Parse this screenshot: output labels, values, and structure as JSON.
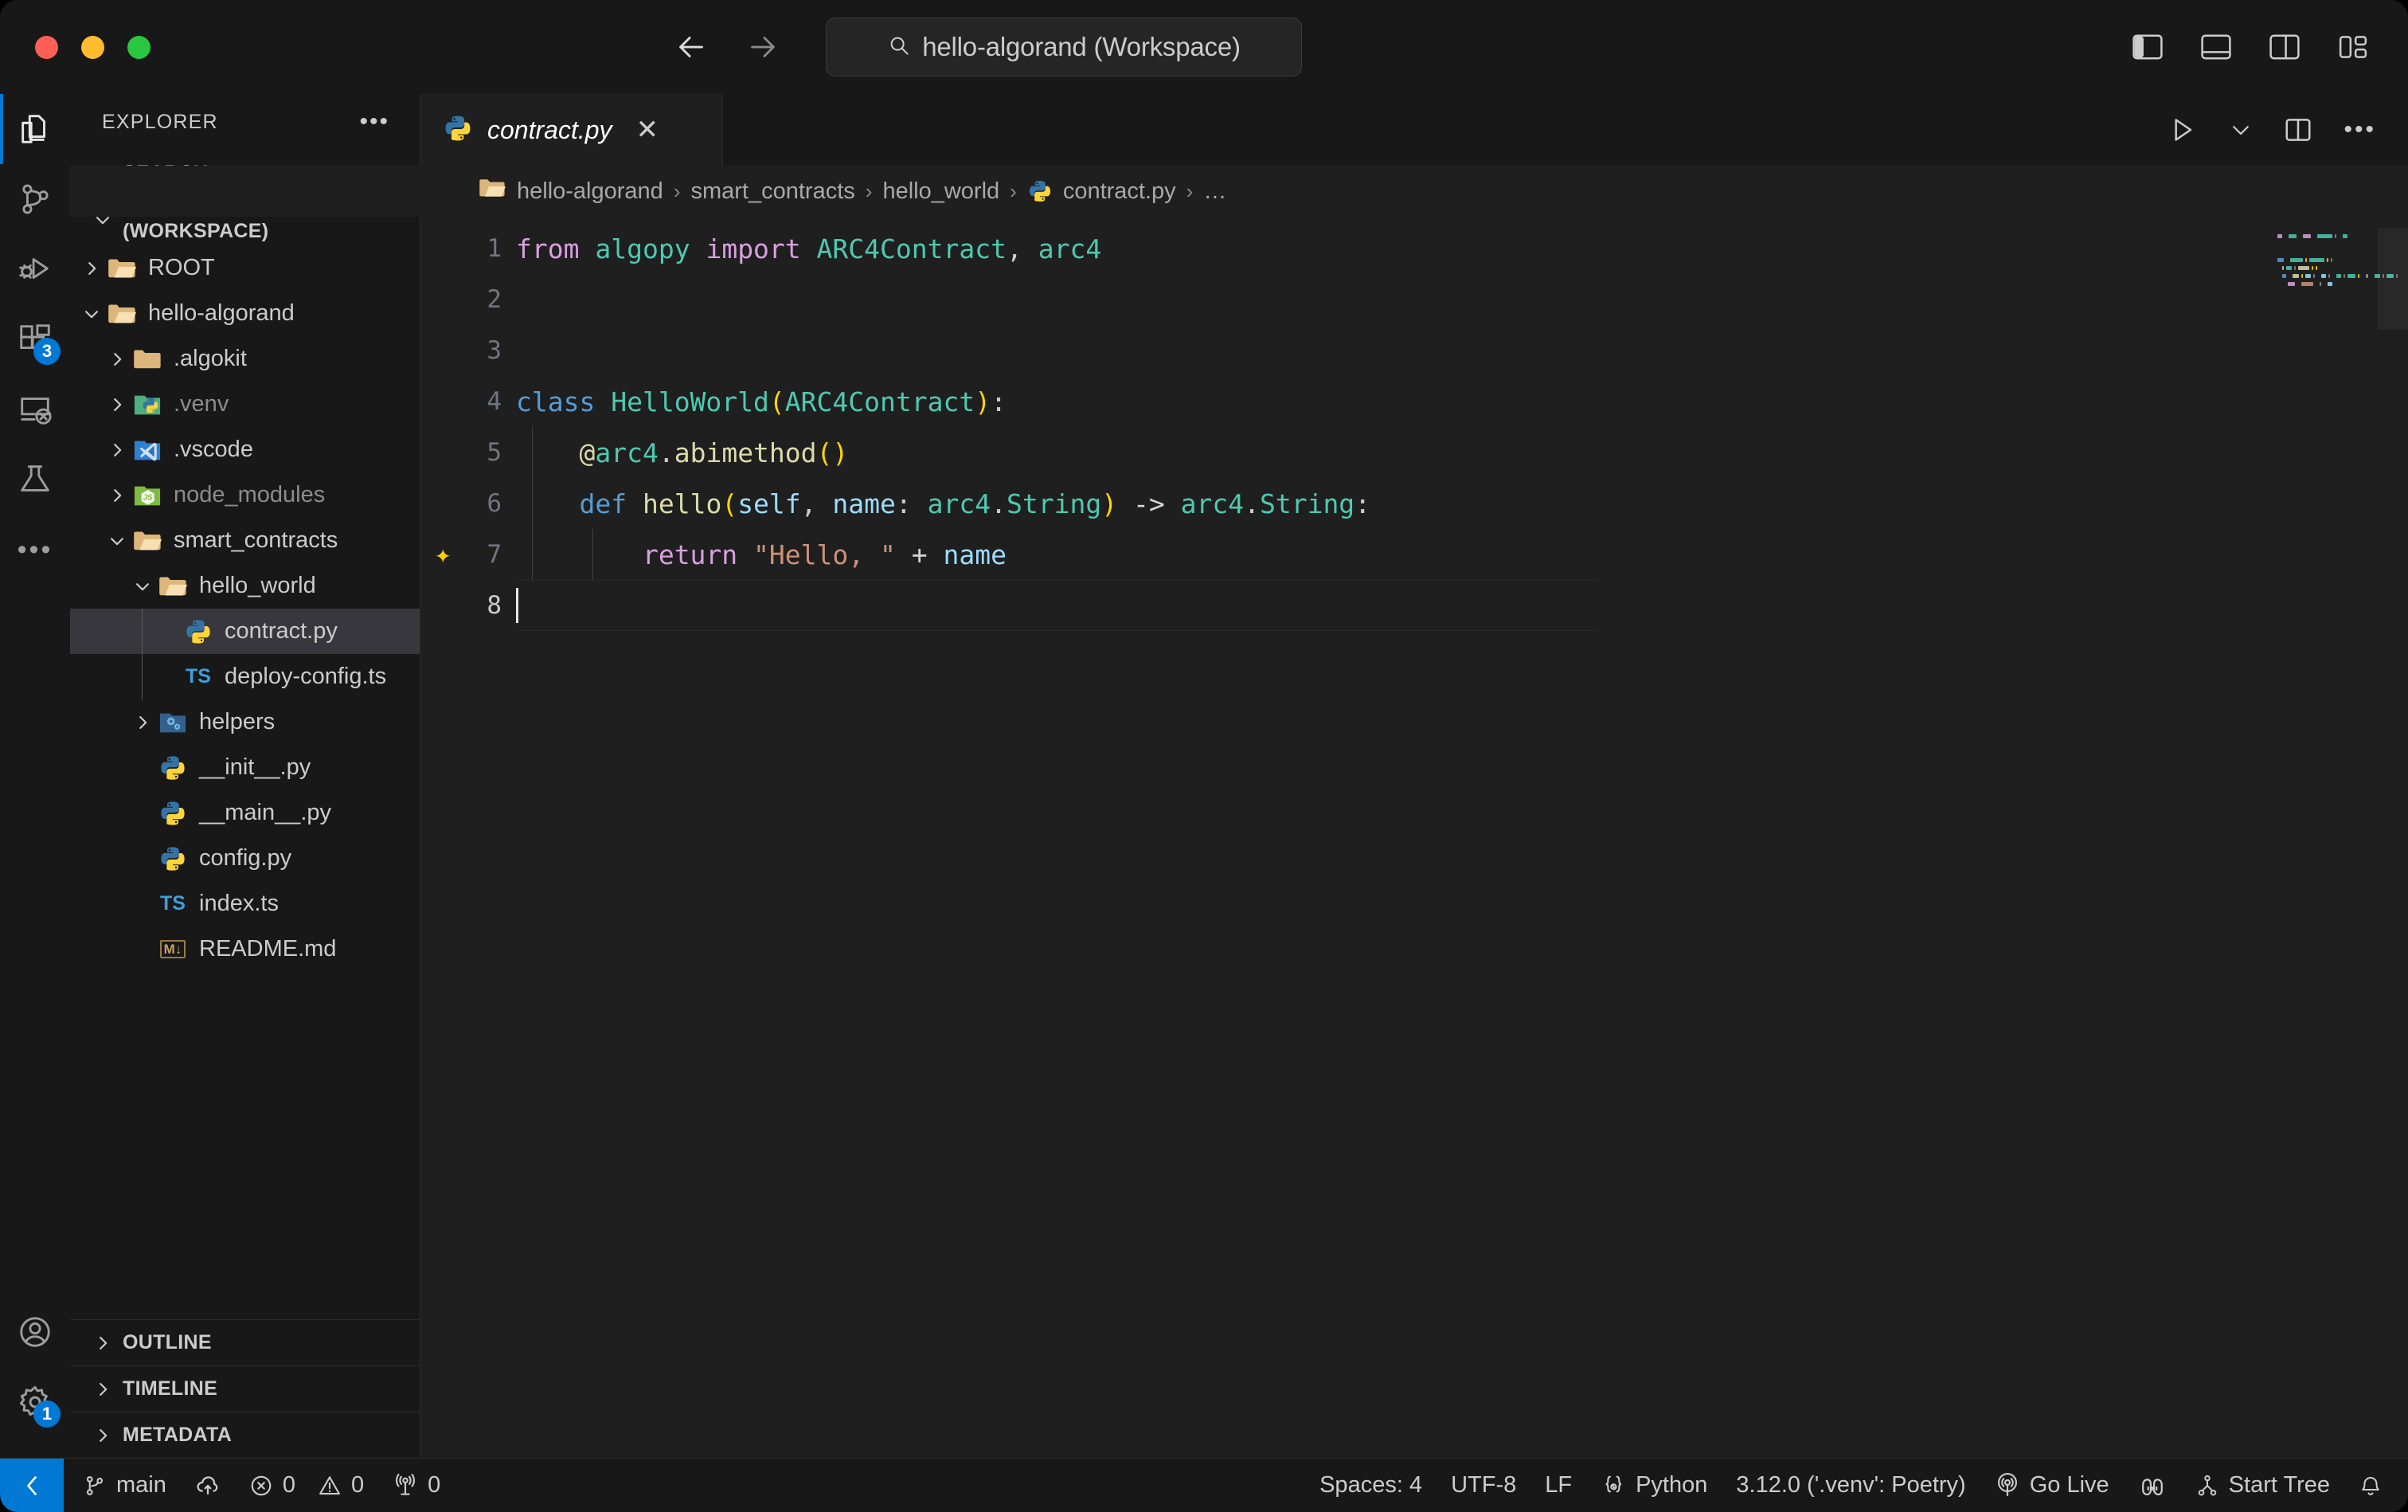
{
  "titlebar": {
    "traffic_lights": [
      "close",
      "minimize",
      "maximize"
    ],
    "search_text": "hello-algorand (Workspace)",
    "search_icon": "search-icon",
    "back_icon": "arrow-left-icon",
    "forward_icon": "arrow-right-icon",
    "layout_buttons": [
      {
        "name": "toggle-primary-sidebar",
        "icon": "layout-sidebar-left-icon"
      },
      {
        "name": "toggle-panel",
        "icon": "layout-panel-bottom-icon"
      },
      {
        "name": "toggle-secondary-sidebar",
        "icon": "layout-sidebar-right-icon"
      },
      {
        "name": "customize-layout",
        "icon": "layout-grid-icon"
      }
    ]
  },
  "activitybar": {
    "items": [
      {
        "name": "explorer",
        "icon": "files-icon",
        "active": true,
        "badge": ""
      },
      {
        "name": "source-control",
        "icon": "source-control-icon",
        "active": false,
        "badge": ""
      },
      {
        "name": "run-and-debug",
        "icon": "run-debug-icon",
        "active": false,
        "badge": ""
      },
      {
        "name": "extensions",
        "icon": "extensions-icon",
        "active": false,
        "badge": "3"
      },
      {
        "name": "remote-explorer",
        "icon": "remote-explorer-icon",
        "active": false,
        "badge": ""
      },
      {
        "name": "testing",
        "icon": "beaker-icon",
        "active": false,
        "badge": ""
      },
      {
        "name": "more-views",
        "icon": "ellipsis-icon",
        "active": false,
        "badge": ""
      }
    ],
    "bottom_items": [
      {
        "name": "accounts",
        "icon": "account-icon",
        "badge": ""
      },
      {
        "name": "manage-settings",
        "icon": "gear-icon",
        "badge": "1"
      }
    ]
  },
  "sidebar": {
    "title": "EXPLORER",
    "more_actions_icon": "ellipsis-icon",
    "sections": [
      {
        "label": "SEARCH",
        "expanded": false
      },
      {
        "label": "HELLO-ALGORAND (WORKSPACE)",
        "expanded": true
      }
    ],
    "bottom_sections": [
      {
        "label": "OUTLINE",
        "expanded": false
      },
      {
        "label": "TIMELINE",
        "expanded": false
      },
      {
        "label": "METADATA",
        "expanded": false
      }
    ],
    "tree": [
      {
        "label": "ROOT",
        "type": "folder",
        "icon": "folder-root-icon",
        "depth": 1,
        "expanded": false,
        "arrow": "chevron-right",
        "selected": false,
        "dim": false
      },
      {
        "label": "hello-algorand",
        "type": "folder",
        "icon": "folder-open-icon",
        "depth": 1,
        "expanded": true,
        "arrow": "chevron-down",
        "selected": false,
        "dim": false
      },
      {
        "label": ".algokit",
        "type": "folder",
        "icon": "folder-plain-icon",
        "depth": 2,
        "expanded": false,
        "arrow": "chevron-right",
        "selected": false,
        "dim": false
      },
      {
        "label": ".venv",
        "type": "folder",
        "icon": "folder-python-icon",
        "depth": 2,
        "expanded": false,
        "arrow": "chevron-right",
        "selected": false,
        "dim": true
      },
      {
        "label": ".vscode",
        "type": "folder",
        "icon": "folder-vscode-icon",
        "depth": 2,
        "expanded": false,
        "arrow": "chevron-right",
        "selected": false,
        "dim": false
      },
      {
        "label": "node_modules",
        "type": "folder",
        "icon": "folder-node-icon",
        "depth": 2,
        "expanded": false,
        "arrow": "chevron-right",
        "selected": false,
        "dim": true
      },
      {
        "label": "smart_contracts",
        "type": "folder",
        "icon": "folder-open-icon",
        "depth": 2,
        "expanded": true,
        "arrow": "chevron-down",
        "selected": false,
        "dim": false
      },
      {
        "label": "hello_world",
        "type": "folder",
        "icon": "folder-open-icon",
        "depth": 3,
        "expanded": true,
        "arrow": "chevron-down",
        "selected": false,
        "dim": false
      },
      {
        "label": "contract.py",
        "type": "file",
        "icon": "python-icon",
        "depth": 4,
        "expanded": false,
        "arrow": "",
        "selected": true,
        "dim": false
      },
      {
        "label": "deploy-config.ts",
        "type": "file",
        "icon": "typescript-icon",
        "depth": 4,
        "expanded": false,
        "arrow": "",
        "selected": false,
        "dim": false
      },
      {
        "label": "helpers",
        "type": "folder",
        "icon": "folder-helpers-icon",
        "depth": 3,
        "expanded": false,
        "arrow": "chevron-right",
        "selected": false,
        "dim": false
      },
      {
        "label": "__init__.py",
        "type": "file",
        "icon": "python-icon",
        "depth": 3,
        "expanded": false,
        "arrow": "",
        "selected": false,
        "dim": false
      },
      {
        "label": "__main__.py",
        "type": "file",
        "icon": "python-icon",
        "depth": 3,
        "expanded": false,
        "arrow": "",
        "selected": false,
        "dim": false
      },
      {
        "label": "config.py",
        "type": "file",
        "icon": "python-icon",
        "depth": 3,
        "expanded": false,
        "arrow": "",
        "selected": false,
        "dim": false
      },
      {
        "label": "index.ts",
        "type": "file",
        "icon": "typescript-icon",
        "depth": 3,
        "expanded": false,
        "arrow": "",
        "selected": false,
        "dim": false
      },
      {
        "label": "README.md",
        "type": "file",
        "icon": "markdown-icon",
        "depth": 3,
        "expanded": false,
        "arrow": "",
        "selected": false,
        "dim": false
      }
    ]
  },
  "editor": {
    "tab": {
      "label": "contract.py",
      "icon": "python-icon",
      "italic_preview": true,
      "close_icon": "close-icon"
    },
    "actions": [
      {
        "name": "run-python-file",
        "icon": "play-icon"
      },
      {
        "name": "run-options",
        "icon": "chevron-down-icon"
      },
      {
        "name": "split-editor-right",
        "icon": "split-editor-icon"
      },
      {
        "name": "more-editor-actions",
        "icon": "ellipsis-icon"
      }
    ],
    "breadcrumb": [
      {
        "label": "hello-algorand",
        "icon": "folder-open-icon"
      },
      {
        "label": "smart_contracts",
        "icon": ""
      },
      {
        "label": "hello_world",
        "icon": ""
      },
      {
        "label": "contract.py",
        "icon": "python-icon"
      },
      {
        "label": "…",
        "icon": ""
      }
    ],
    "gutter_sparkle_line": 7,
    "cursor_line": 8,
    "lines": [
      {
        "n": 1,
        "tokens": [
          {
            "t": "from",
            "c": "k-import"
          },
          {
            "t": " ",
            "c": "punct"
          },
          {
            "t": "algopy",
            "c": "id-green"
          },
          {
            "t": " ",
            "c": "punct"
          },
          {
            "t": "import",
            "c": "k-import"
          },
          {
            "t": " ",
            "c": "punct"
          },
          {
            "t": "ARC4Contract",
            "c": "id-green"
          },
          {
            "t": ",",
            "c": "punct"
          },
          {
            "t": " ",
            "c": "punct"
          },
          {
            "t": "arc4",
            "c": "id-green"
          }
        ]
      },
      {
        "n": 2,
        "tokens": []
      },
      {
        "n": 3,
        "tokens": []
      },
      {
        "n": 4,
        "tokens": [
          {
            "t": "class",
            "c": "k-def"
          },
          {
            "t": " ",
            "c": "punct"
          },
          {
            "t": "HelloWorld",
            "c": "id-green"
          },
          {
            "t": "(",
            "c": "paren"
          },
          {
            "t": "ARC4Contract",
            "c": "id-green"
          },
          {
            "t": ")",
            "c": "paren"
          },
          {
            "t": ":",
            "c": "punct"
          }
        ]
      },
      {
        "n": 5,
        "tokens": [
          {
            "t": "    ",
            "c": "punct"
          },
          {
            "t": "@",
            "c": "fn-name"
          },
          {
            "t": "arc4",
            "c": "id-green"
          },
          {
            "t": ".",
            "c": "punct"
          },
          {
            "t": "abimethod",
            "c": "fn-name"
          },
          {
            "t": "(",
            "c": "paren"
          },
          {
            "t": ")",
            "c": "paren"
          }
        ]
      },
      {
        "n": 6,
        "tokens": [
          {
            "t": "    ",
            "c": "punct"
          },
          {
            "t": "def",
            "c": "k-def"
          },
          {
            "t": " ",
            "c": "punct"
          },
          {
            "t": "hello",
            "c": "fn-name"
          },
          {
            "t": "(",
            "c": "paren"
          },
          {
            "t": "self",
            "c": "param"
          },
          {
            "t": ",",
            "c": "punct"
          },
          {
            "t": " ",
            "c": "punct"
          },
          {
            "t": "name",
            "c": "param"
          },
          {
            "t": ":",
            "c": "punct"
          },
          {
            "t": " ",
            "c": "punct"
          },
          {
            "t": "arc4",
            "c": "id-green"
          },
          {
            "t": ".",
            "c": "punct"
          },
          {
            "t": "String",
            "c": "id-green"
          },
          {
            "t": ")",
            "c": "paren"
          },
          {
            "t": " ",
            "c": "punct"
          },
          {
            "t": "->",
            "c": "op"
          },
          {
            "t": " ",
            "c": "punct"
          },
          {
            "t": "arc4",
            "c": "id-green"
          },
          {
            "t": ".",
            "c": "punct"
          },
          {
            "t": "String",
            "c": "id-green"
          },
          {
            "t": ":",
            "c": "punct"
          }
        ]
      },
      {
        "n": 7,
        "tokens": [
          {
            "t": "        ",
            "c": "punct"
          },
          {
            "t": "return",
            "c": "k-import"
          },
          {
            "t": " ",
            "c": "punct"
          },
          {
            "t": "\"Hello, \"",
            "c": "str"
          },
          {
            "t": " ",
            "c": "punct"
          },
          {
            "t": "+",
            "c": "op"
          },
          {
            "t": " ",
            "c": "punct"
          },
          {
            "t": "name",
            "c": "param"
          }
        ]
      },
      {
        "n": 8,
        "tokens": []
      }
    ]
  },
  "statusbar": {
    "remote_icon": "remote-window-icon",
    "left": [
      {
        "name": "branch",
        "icon": "source-control-icon",
        "label": "main"
      },
      {
        "name": "sync-changes",
        "icon": "cloud-upload-icon",
        "label": ""
      },
      {
        "name": "errors",
        "icon": "error-circle-icon",
        "label": "0"
      },
      {
        "name": "warnings",
        "icon": "warning-triangle-icon",
        "label": "0"
      },
      {
        "name": "ports",
        "icon": "radio-tower-icon",
        "label": "0"
      }
    ],
    "right": [
      {
        "name": "indentation",
        "icon": "",
        "label": "Spaces: 4"
      },
      {
        "name": "encoding",
        "icon": "",
        "label": "UTF-8"
      },
      {
        "name": "eol",
        "icon": "",
        "label": "LF"
      },
      {
        "name": "language-mode",
        "icon": "python-brackets-icon",
        "label": "Python"
      },
      {
        "name": "interpreter",
        "icon": "",
        "label": "3.12.0 ('.venv': Poetry)"
      },
      {
        "name": "go-live",
        "icon": "broadcast-icon",
        "label": "Go Live"
      },
      {
        "name": "copilot",
        "icon": "copilot-icon",
        "label": ""
      },
      {
        "name": "start-tree",
        "icon": "tree-icon",
        "label": "Start Tree"
      },
      {
        "name": "notifications",
        "icon": "bell-icon",
        "label": ""
      }
    ]
  },
  "colors": {
    "accent": "#0078d4",
    "editor_bg": "#1f1f1f",
    "chrome_bg": "#181818",
    "selection": "#37373d"
  }
}
